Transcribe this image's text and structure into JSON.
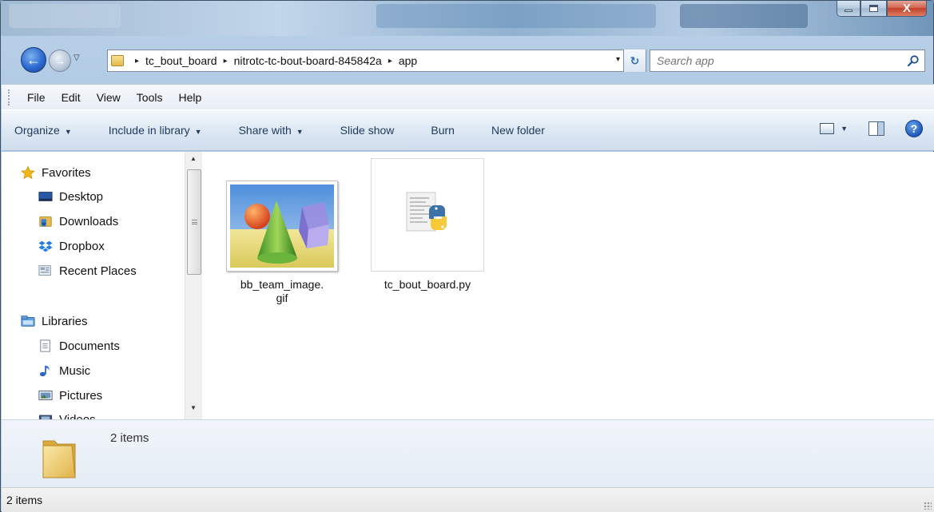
{
  "window": {
    "controls": [
      "minimize",
      "maximize",
      "close"
    ],
    "close_glyph": "X"
  },
  "nav": {
    "back_glyph": "←",
    "forward_glyph": "→",
    "history_glyph": "▽"
  },
  "address": {
    "breadcrumbs": [
      "tc_bout_board",
      "nitrotc-tc-bout-board-845842a",
      "app"
    ],
    "separator": "▸",
    "dropdown_glyph": "▾",
    "refresh_glyph": "↻"
  },
  "search": {
    "placeholder": "Search app"
  },
  "menubar": {
    "items": [
      "File",
      "Edit",
      "View",
      "Tools",
      "Help"
    ]
  },
  "commandbar": {
    "items": [
      {
        "label": "Organize",
        "has_dropdown": true
      },
      {
        "label": "Include in library",
        "has_dropdown": true
      },
      {
        "label": "Share with",
        "has_dropdown": true
      },
      {
        "label": "Slide show",
        "has_dropdown": false
      },
      {
        "label": "Burn",
        "has_dropdown": false
      },
      {
        "label": "New folder",
        "has_dropdown": false
      }
    ],
    "dropdown_glyph": "▼",
    "view_caret": "▼",
    "help_glyph": "?"
  },
  "navpane": {
    "favorites": {
      "header": "Favorites",
      "items": [
        "Desktop",
        "Downloads",
        "Dropbox",
        "Recent Places"
      ]
    },
    "libraries": {
      "header": "Libraries",
      "items": [
        "Documents",
        "Music",
        "Pictures",
        "Videos"
      ]
    },
    "scroll_up": "▲",
    "scroll_down": "▼"
  },
  "files": [
    {
      "name_line1": "bb_team_image.",
      "name_line2": "gif",
      "icon": "image-gif-icon"
    },
    {
      "name_line1": "tc_bout_board.py",
      "name_line2": "",
      "icon": "python-file-icon"
    }
  ],
  "details": {
    "count": "2 items"
  },
  "statusbar": {
    "text": "2 items"
  },
  "colors": {
    "accent": "#1e395b",
    "favorites_star": "#f2b818",
    "python_blue": "#3b73a8",
    "python_yellow": "#f5c93a"
  }
}
